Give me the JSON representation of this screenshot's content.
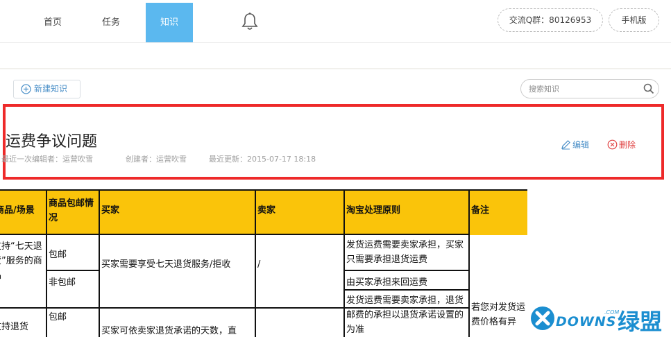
{
  "nav": {
    "items": [
      {
        "label": "首页",
        "active": false
      },
      {
        "label": "任务",
        "active": false
      },
      {
        "label": "知识",
        "active": true
      }
    ],
    "bell_icon": "bell-icon",
    "qq_group": "交流Q群：80126953",
    "mobile": "手机版"
  },
  "toolbar": {
    "new_label": "新建知识",
    "search_placeholder": "搜索知识"
  },
  "doc": {
    "title": "运费争议问题",
    "last_editor": "最近一次编辑者：运营吹雪",
    "creator": "创建者：运营吹雪",
    "updated": "最近更新：2015-07-17 18:18",
    "edit_label": "编辑",
    "delete_label": "删除"
  },
  "table": {
    "headers": [
      "商品/场景",
      "商品包邮情况",
      "买家",
      "卖家",
      "淘宝处理原则",
      "备注"
    ],
    "row1": {
      "scene": "支持“七天退货”服务的商品",
      "ship_free": "包邮",
      "ship_paid": "非包邮",
      "buyer": "买家需要享受七天退货服务/拒收",
      "seller": "/",
      "rule_free": "发货运费需要卖家承担，买家只需要承担退货运费",
      "rule_paid": "由买家承担来回运费",
      "note": "若您对发货运费价格有异"
    },
    "row2": {
      "scene": "支持退货",
      "ship_free": "包邮",
      "buyer": "买家可依卖家退货承诺的天数，直",
      "rule": "发货运费需要卖家承担，退货邮费的承担以退货承诺设置的为准"
    }
  },
  "watermark": {
    "brand": "DOWNS",
    "cn": "绿盟",
    "com": ".COM"
  },
  "colors": {
    "accent": "#5bb8ef",
    "highlight_border": "#ee2a2a",
    "table_header": "#fac40a",
    "link": "#4a8fc8",
    "danger": "#e04040"
  }
}
